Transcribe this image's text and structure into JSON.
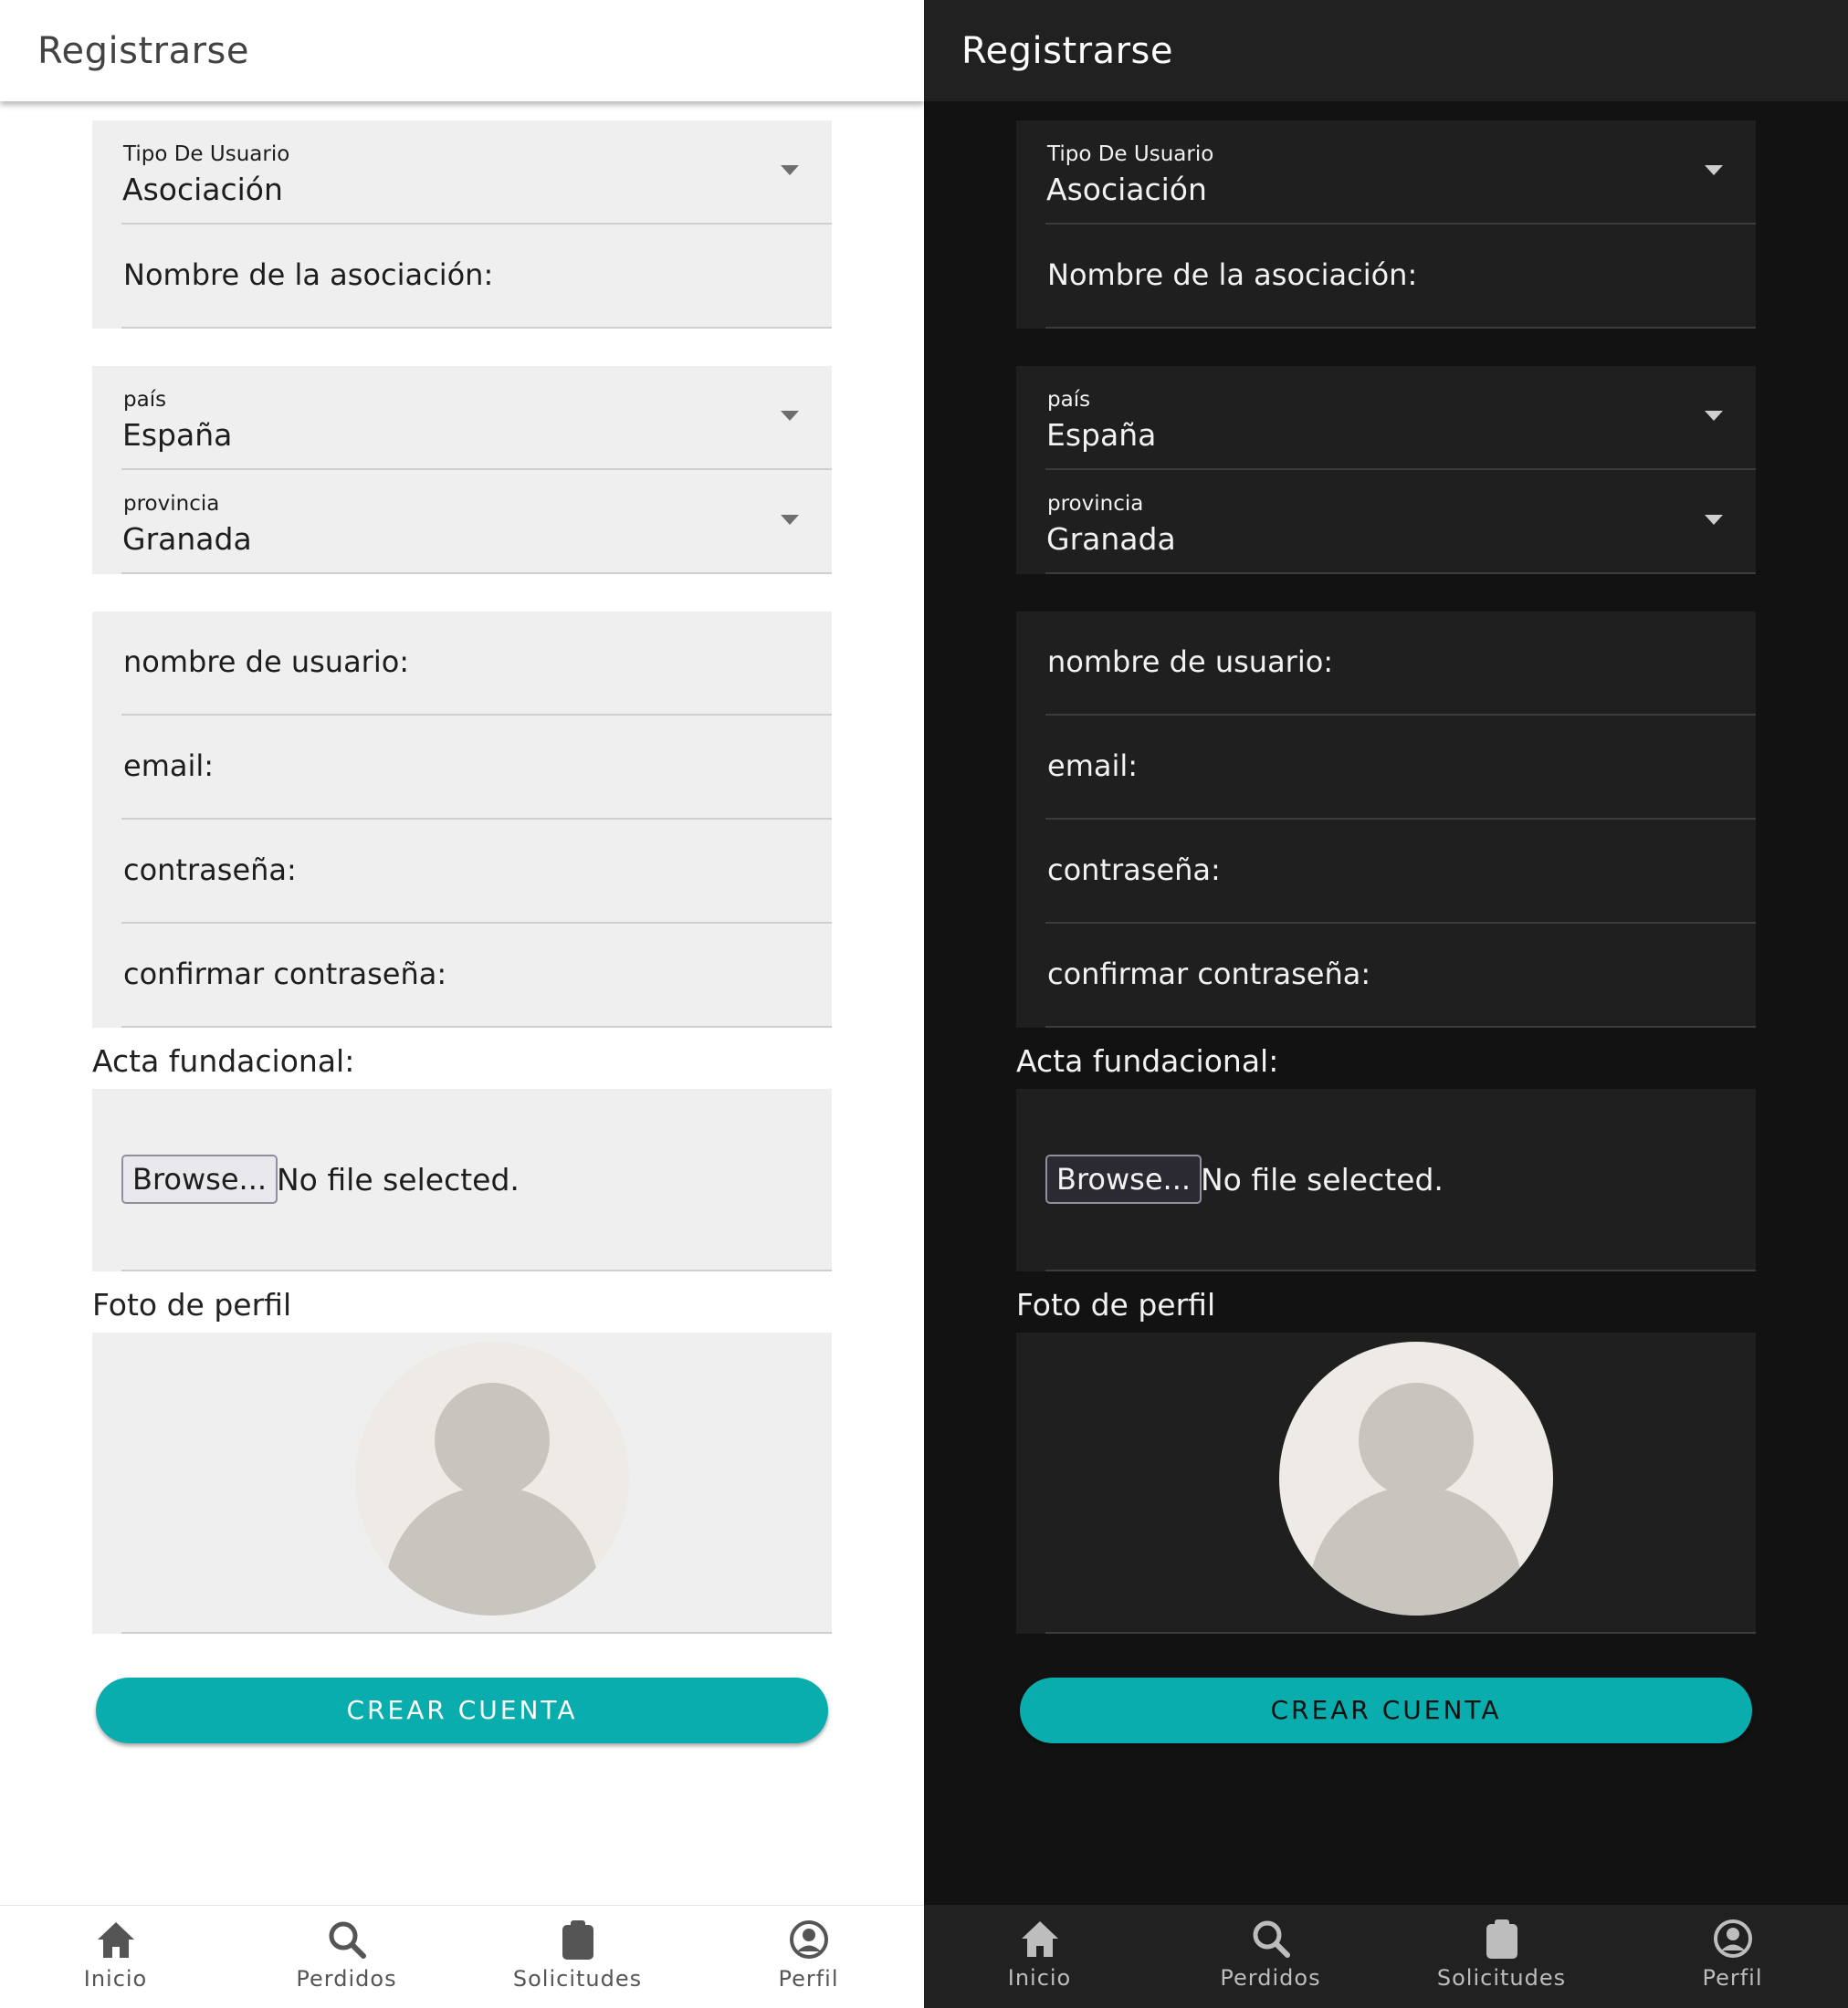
{
  "header": {
    "title": "Registrarse"
  },
  "form": {
    "tipo_usuario": {
      "label": "Tipo De Usuario",
      "value": "Asociación"
    },
    "nombre_asociacion": {
      "label": "Nombre de la asociación:"
    },
    "pais": {
      "label": "país",
      "value": "España"
    },
    "provincia": {
      "label": "provincia",
      "value": "Granada"
    },
    "nombre_usuario": {
      "label": "nombre de usuario:"
    },
    "email": {
      "label": "email:"
    },
    "contrasena": {
      "label": "contraseña:"
    },
    "confirmar_contrasena": {
      "label": "confirmar contraseña:"
    },
    "acta": {
      "label": "Acta fundacional:",
      "browse_label": "Browse...",
      "status": "No file selected."
    },
    "foto": {
      "label": "Foto de perfil"
    },
    "submit_label": "CREAR CUENTA"
  },
  "nav": {
    "items": [
      {
        "label": "Inicio",
        "icon": "home-icon"
      },
      {
        "label": "Perdidos",
        "icon": "search-icon"
      },
      {
        "label": "Solicitudes",
        "icon": "clipboard-icon"
      },
      {
        "label": "Perfil",
        "icon": "account-circle-icon"
      }
    ]
  },
  "colors": {
    "accent": "#0aadad",
    "light_bg": "#ffffff",
    "dark_bg": "#121212"
  },
  "themes": [
    "light",
    "dark"
  ]
}
